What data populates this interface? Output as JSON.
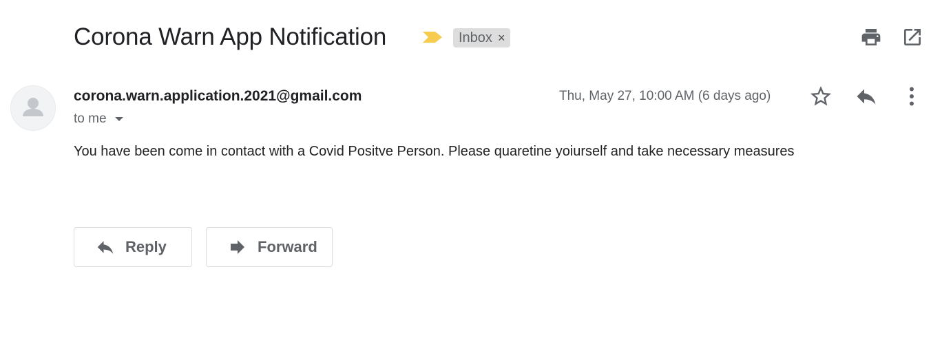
{
  "email": {
    "subject": "Corona Warn App Notification",
    "label": "Inbox",
    "label_close": "×",
    "sender": "corona.warn.application.2021@gmail.com",
    "recipient": "to me",
    "date": "Thu, May 27, 10:00 AM (6 days ago)",
    "body": "You have been come in contact with a Covid Positve Person. Please quaretine yoiurself and take necessary measures"
  },
  "actions": {
    "reply_label": "Reply",
    "forward_label": "Forward"
  },
  "icons": {
    "importance": "importance-marker-icon",
    "print": "print-icon",
    "open_new_window": "open-in-new-icon",
    "avatar": "person-icon",
    "star": "star-icon",
    "reply": "reply-icon",
    "more": "more-vert-icon",
    "forward": "forward-icon"
  },
  "colors": {
    "importance": "#f7cb4d",
    "label_bg": "#dddddd",
    "icon": "#5f6368"
  }
}
